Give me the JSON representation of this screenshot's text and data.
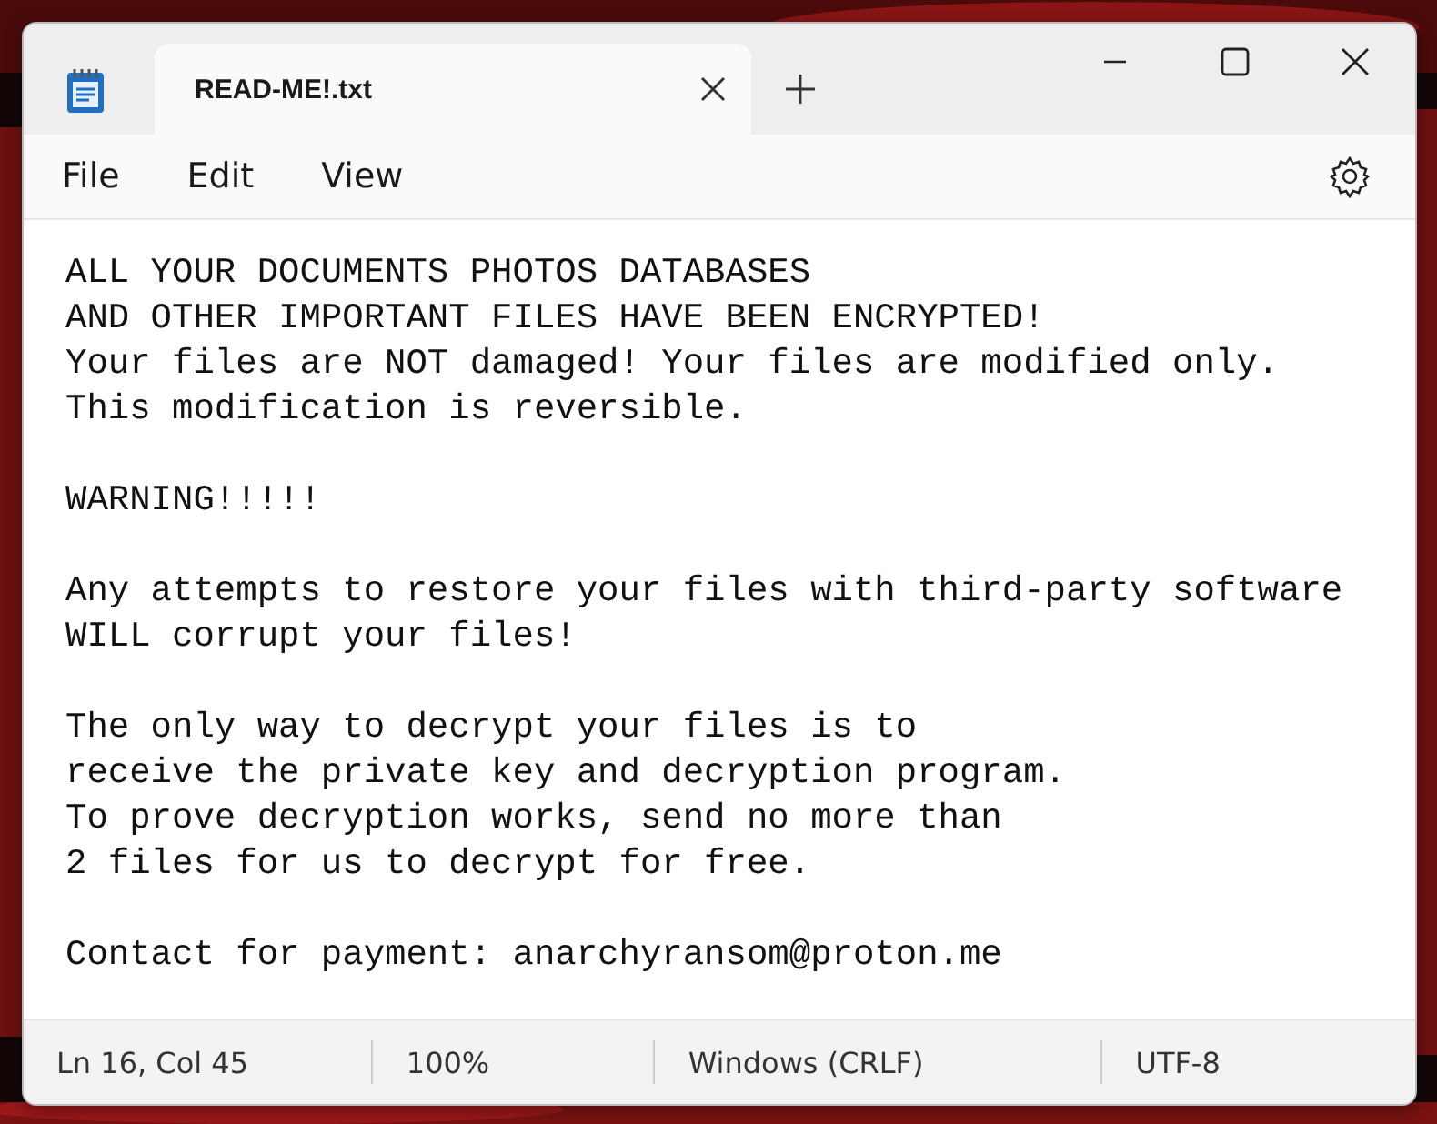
{
  "tabs": [
    {
      "title": "READ-ME!.txt",
      "selected": true
    }
  ],
  "menu": [
    "File",
    "Edit",
    "View"
  ],
  "document": {
    "paragraphs": [
      [
        "ALL YOUR DOCUMENTS PHOTOS DATABASES",
        "AND OTHER IMPORTANT FILES HAVE BEEN ENCRYPTED!",
        "Your files are NOT damaged! Your files are modified only.",
        "This modification is reversible."
      ],
      [
        "WARNING!!!!!"
      ],
      [
        "Any attempts to restore your files with third-party software",
        "WILL corrupt your files!"
      ],
      [
        "The only way to decrypt your files is to",
        "receive the private key and decryption program.",
        "To prove decryption works, send no more than",
        "2 files for us to decrypt for free."
      ],
      [
        "Contact for payment: anarchyransom@proton.me"
      ]
    ]
  },
  "status_bar": [
    "Ln 16, Col 45",
    "100%",
    "Windows (CRLF)",
    "UTF-8"
  ]
}
